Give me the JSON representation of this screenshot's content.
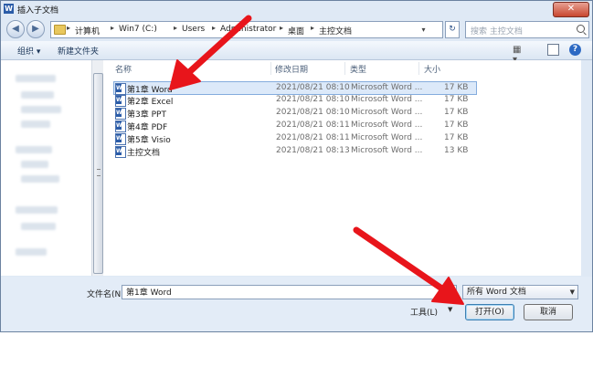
{
  "window": {
    "title": "插入子文档",
    "close": "✕"
  },
  "nav": {
    "back": "◀",
    "forward": "▶",
    "breadcrumbs": [
      "计算机",
      "Win7 (C:)",
      "Users",
      "Administrator",
      "桌面",
      "主控文档"
    ],
    "separator": "▸",
    "address_dropdown": "▾",
    "refresh": "↻",
    "search_placeholder": "搜索 主控文档"
  },
  "toolbar": {
    "organize": "组织 ▾",
    "new_folder": "新建文件夹",
    "view": "▦ ▾",
    "help": "?"
  },
  "columns": {
    "name": "名称",
    "modified": "修改日期",
    "type": "类型",
    "size": "大小"
  },
  "files": [
    {
      "name": "第1章 Word",
      "modified": "2021/08/21 08:10",
      "type": "Microsoft Word ...",
      "size": "17 KB"
    },
    {
      "name": "第2章 Excel",
      "modified": "2021/08/21 08:10",
      "type": "Microsoft Word ...",
      "size": "17 KB"
    },
    {
      "name": "第3章 PPT",
      "modified": "2021/08/21 08:10",
      "type": "Microsoft Word ...",
      "size": "17 KB"
    },
    {
      "name": "第4章 PDF",
      "modified": "2021/08/21 08:11",
      "type": "Microsoft Word ...",
      "size": "17 KB"
    },
    {
      "name": "第5章 Visio",
      "modified": "2021/08/21 08:11",
      "type": "Microsoft Word ...",
      "size": "17 KB"
    },
    {
      "name": "主控文档",
      "modified": "2021/08/21 08:13",
      "type": "Microsoft Word ...",
      "size": "13 KB"
    }
  ],
  "bottom": {
    "filename_label": "文件名(N):",
    "filename_value": "第1章 Word",
    "filetype": "所有 Word 文档",
    "tools": "工具(L)",
    "open": "打开(O)",
    "cancel": "取消"
  },
  "colors": {
    "arrow": "#e8151b",
    "selection": "#dce9f9",
    "window_bg": "#dfe9f5"
  }
}
